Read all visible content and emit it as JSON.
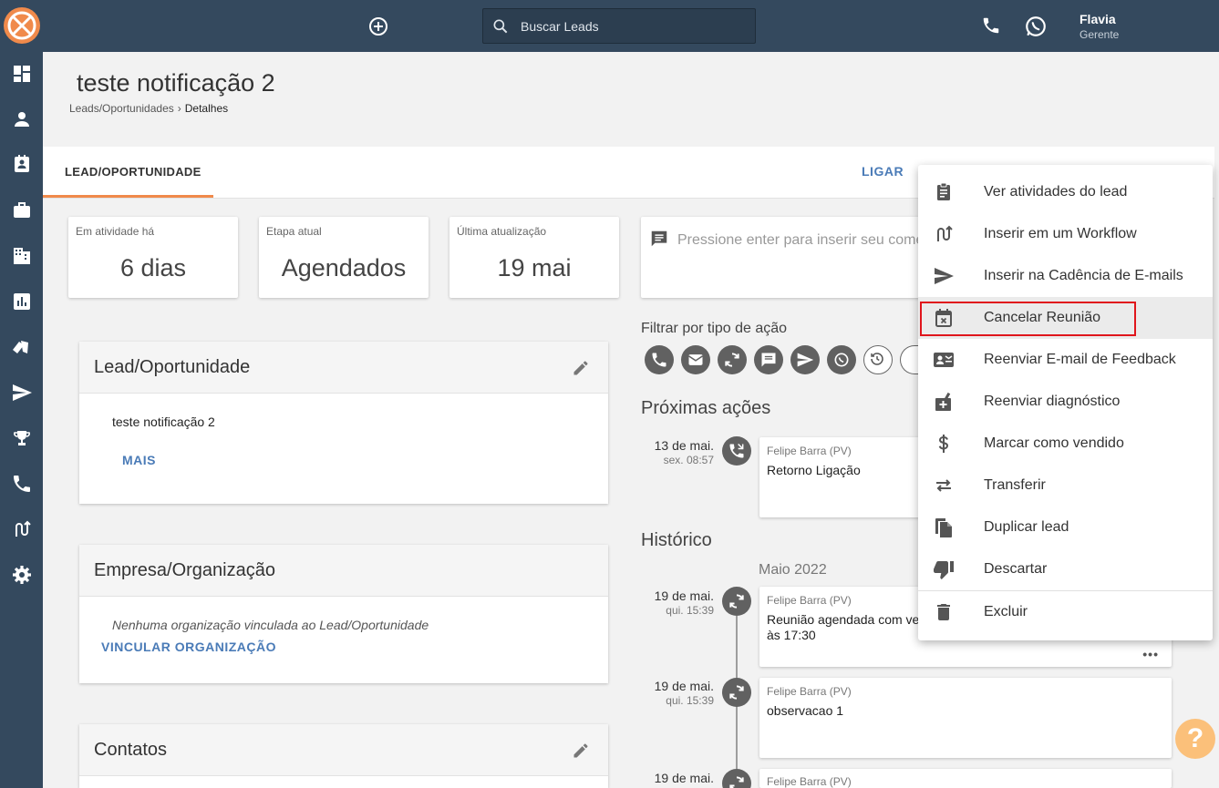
{
  "topbar": {
    "search_placeholder": "Buscar Leads",
    "user_name": "Flavia",
    "user_role": "Gerente"
  },
  "header": {
    "title": "teste notificação 2",
    "breadcrumb": [
      "Leads/Oportunidades",
      "Detalhes"
    ]
  },
  "tabs": {
    "lead": "LEAD/OPORTUNIDADE",
    "ligar": "LIGAR"
  },
  "stats": [
    {
      "label": "Em atividade há",
      "value": "6 dias"
    },
    {
      "label": "Etapa atual",
      "value": "Agendados"
    },
    {
      "label": "Última atualização",
      "value": "19 mai"
    }
  ],
  "comment": {
    "placeholder": "Pressione enter para inserir seu come"
  },
  "panels": {
    "lead": {
      "title": "Lead/Oportunidade",
      "name": "teste notificação 2",
      "more": "MAIS"
    },
    "org": {
      "title": "Empresa/Organização",
      "empty": "Nenhuma organização vinculada ao Lead/Oportunidade",
      "link": "VINCULAR ORGANIZAÇÃO"
    },
    "contacts": {
      "title": "Contatos"
    }
  },
  "filter": {
    "label": "Filtrar por tipo de ação"
  },
  "next_actions": {
    "title": "Próximas ações",
    "items": [
      {
        "date": "13 de mai.",
        "time": "sex. 08:57",
        "author": "Felipe Barra (PV)",
        "text": "Retorno Ligação"
      }
    ]
  },
  "history": {
    "title": "Histórico",
    "month": "Maio 2022",
    "items": [
      {
        "date": "19 de mai.",
        "time": "qui. 15:39",
        "author": "Felipe Barra (PV)",
        "text": "Reunião agendada com ver",
        "text2": "às 17:30",
        "more": "•••"
      },
      {
        "date": "19 de mai.",
        "time": "qui. 15:39",
        "author": "Felipe Barra (PV)",
        "text": "observacao 1"
      },
      {
        "date": "19 de mai.",
        "time": "",
        "author": "Felipe Barra (PV)"
      }
    ]
  },
  "menu": {
    "items": [
      {
        "label": "Ver atividades do lead",
        "icon": "assignment-icon"
      },
      {
        "label": "Inserir em um Workflow",
        "icon": "workflow-icon"
      },
      {
        "label": "Inserir na Cadência de E-mails",
        "icon": "send-icon"
      },
      {
        "label": "Cancelar Reunião",
        "icon": "event-busy-icon"
      },
      {
        "label": "Reenviar E-mail de Feedback",
        "icon": "contact-mail-icon"
      },
      {
        "label": "Reenviar diagnóstico",
        "icon": "diagnostic-icon"
      },
      {
        "label": "Marcar como vendido",
        "icon": "dollar-icon"
      },
      {
        "label": "Transferir",
        "icon": "swap-icon"
      },
      {
        "label": "Duplicar lead",
        "icon": "copy-icon"
      },
      {
        "label": "Descartar",
        "icon": "thumb-down-icon"
      },
      {
        "label": "Excluir",
        "icon": "trash-icon"
      }
    ]
  },
  "colors": {
    "sidebar": "#34495e",
    "accent": "#f08a4b",
    "link": "#4a7bb7",
    "highlight": "#e0161c"
  }
}
